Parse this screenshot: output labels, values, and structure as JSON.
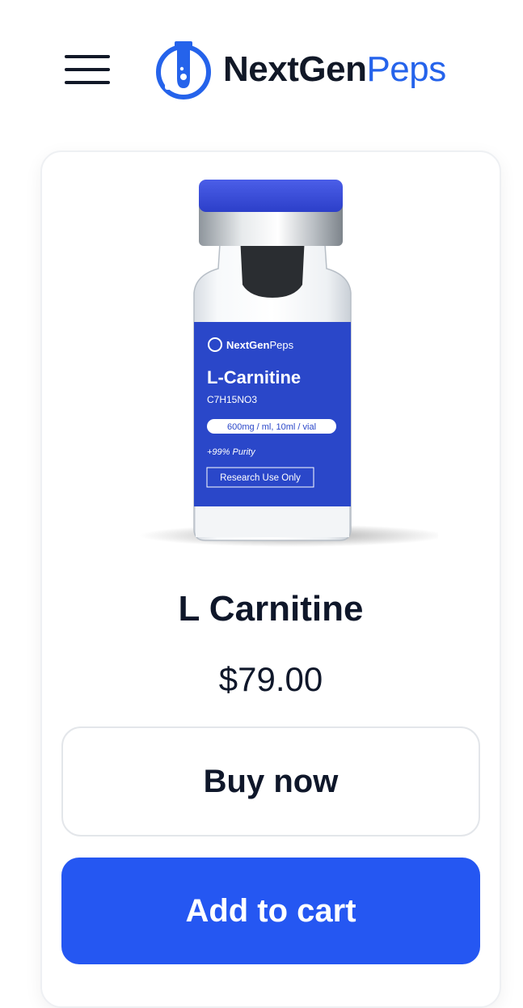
{
  "header": {
    "logo_text_bold": "NextGen",
    "logo_text_light": "Peps",
    "menu_icon": "hamburger-icon"
  },
  "product": {
    "name": "L Carnitine",
    "price": "$79.00",
    "image": {
      "brand_bold": "NextGen",
      "brand_light": "Peps",
      "label_title": "L-Carnitine",
      "formula": "C7H15NO3",
      "dosage": "600mg / ml, 10ml / vial",
      "purity": "+99% Purity",
      "research_note": "Research Use Only"
    }
  },
  "actions": {
    "buy_label": "Buy now",
    "cart_label": "Add to cart"
  },
  "colors": {
    "brand_blue": "#2563eb",
    "cart_button": "#2557f2",
    "label_blue": "#2a47c9",
    "cap_blue": "#3348d6"
  }
}
